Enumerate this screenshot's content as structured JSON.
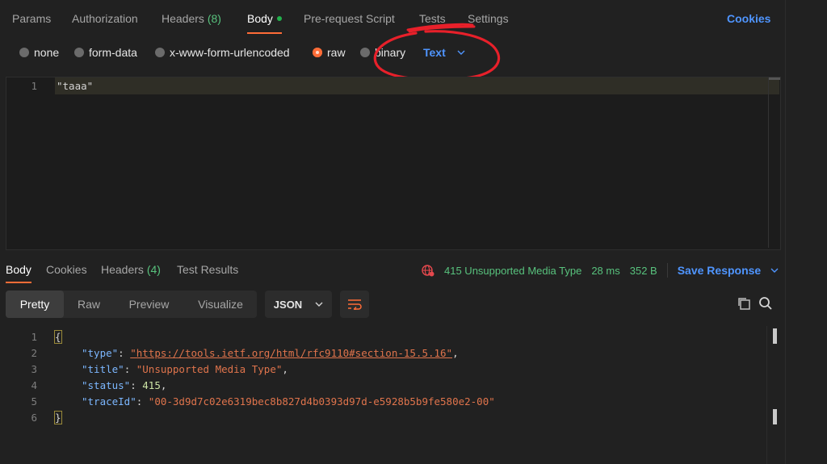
{
  "request_tabs": [
    {
      "label": "Params"
    },
    {
      "label": "Authorization"
    },
    {
      "label": "Headers",
      "count": "(8)"
    },
    {
      "label": "Body",
      "active": true
    },
    {
      "label": "Pre-request Script"
    },
    {
      "label": "Tests"
    },
    {
      "label": "Settings"
    }
  ],
  "cookies_link": "Cookies",
  "body_types": [
    "none",
    "form-data",
    "x-www-form-urlencoded",
    "raw",
    "binary"
  ],
  "body_selected": "raw",
  "raw_format": "Text",
  "editor": {
    "lines": [
      {
        "num": "1",
        "text": "\"taaa\""
      }
    ]
  },
  "response_tabs": [
    {
      "label": "Body",
      "active": true
    },
    {
      "label": "Cookies"
    },
    {
      "label": "Headers",
      "count": "(4)"
    },
    {
      "label": "Test Results"
    }
  ],
  "response_meta": {
    "status": "415 Unsupported Media Type",
    "time": "28 ms",
    "size": "352 B",
    "save_label": "Save Response"
  },
  "view_modes": [
    "Pretty",
    "Raw",
    "Preview",
    "Visualize"
  ],
  "view_selected": "Pretty",
  "response_format": "JSON",
  "response_lines": {
    "l1": {
      "num": "1",
      "text": "{"
    },
    "l2": {
      "num": "2",
      "key": "\"type\"",
      "value": "\"https://tools.ietf.org/html/rfc9110#section-15.5.16\""
    },
    "l3": {
      "num": "3",
      "key": "\"title\"",
      "value": "\"Unsupported Media Type\""
    },
    "l4": {
      "num": "4",
      "key": "\"status\"",
      "value": "415"
    },
    "l5": {
      "num": "5",
      "key": "\"traceId\"",
      "value": "\"00-3d9d7c02e6319bec8b827d4b0393d97d-e5928b5b9fe580e2-00\""
    },
    "l6": {
      "num": "6",
      "text": "}"
    }
  },
  "colors": {
    "accent": "#ff6c37",
    "link": "#4f95ff",
    "success": "#58c27d",
    "annotation": "#e8202a"
  },
  "icons": [
    "globe-error-icon",
    "chevron-down-icon",
    "wrap-lines-icon",
    "copy-icon",
    "search-icon"
  ]
}
